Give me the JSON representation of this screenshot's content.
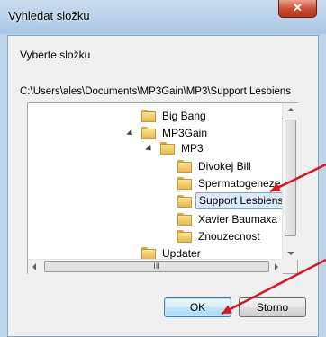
{
  "window": {
    "title": "Vyhledat složku",
    "close_glyph": "✕"
  },
  "dialog": {
    "prompt": "Vyberte složku",
    "path": "C:\\Users\\ales\\Documents\\MP3Gain\\MP3\\Support Lesbiens"
  },
  "tree": {
    "items": [
      {
        "label": "Big Bang",
        "icon": "folder-icon"
      },
      {
        "label": "MP3Gain",
        "icon": "folder-icon"
      },
      {
        "label": "MP3",
        "icon": "folder-icon"
      },
      {
        "label": "Divokej Bill",
        "icon": "folder-icon"
      },
      {
        "label": "Spermatogeneze",
        "icon": "folder-icon"
      },
      {
        "label": "Support Lesbiens",
        "icon": "folder-icon",
        "selected": true
      },
      {
        "label": "Xavier Baumaxa",
        "icon": "folder-icon"
      },
      {
        "label": "Znouzecnost",
        "icon": "folder-icon"
      },
      {
        "label": "Updater",
        "icon": "folder-icon"
      }
    ]
  },
  "scrollbar": {
    "grip": "III"
  },
  "buttons": {
    "ok": "OK",
    "cancel": "Storno"
  },
  "colors": {
    "annotation_arrow": "#d9161c",
    "selection": "#dcebfc",
    "ok_border": "#3c7fb1"
  }
}
